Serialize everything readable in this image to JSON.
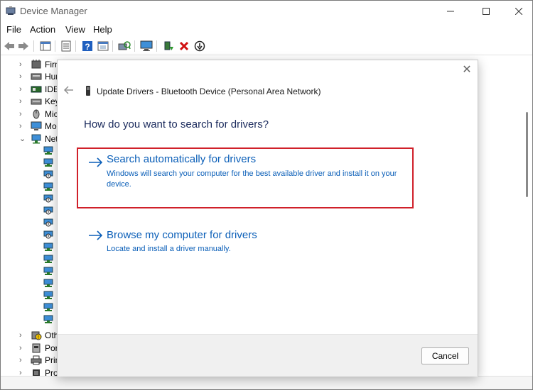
{
  "window": {
    "title": "Device Manager",
    "controls": {
      "minimize": "—",
      "maximize": "☐",
      "close": "✕"
    }
  },
  "menu": [
    "File",
    "Action",
    "View",
    "Help"
  ],
  "toolbar": {
    "icons": [
      "back-arrow-icon",
      "forward-arrow-icon",
      "properties-icon",
      "show-hidden-icon",
      "help-icon",
      "console-tree-icon",
      "scan-hardware-icon",
      "monitor-icon",
      "update-driver-icon",
      "uninstall-device-icon",
      "disable-device-icon"
    ]
  },
  "tree": {
    "items": [
      {
        "label": "Firmware",
        "visible_text": "Firm",
        "expanded": false
      },
      {
        "label": "Human Interface Devices",
        "visible_text": "Hum",
        "expanded": false
      },
      {
        "label": "IDE ATA/ATAPI controllers",
        "visible_text": "IDE",
        "expanded": false
      },
      {
        "label": "Keyboards",
        "visible_text": "Key",
        "expanded": false
      },
      {
        "label": "Mice and other pointing devices",
        "visible_text": "Mic",
        "expanded": false
      },
      {
        "label": "Monitors",
        "visible_text": "Mo",
        "expanded": false
      },
      {
        "label": "Network adapters",
        "visible_text": "Net",
        "expanded": true
      },
      {
        "label": "Other devices",
        "visible_text": "Oth",
        "expanded": false
      },
      {
        "label": "Ports (COM & LPT)",
        "visible_text": "Por",
        "expanded": false
      },
      {
        "label": "Print queues",
        "visible_text": "Prin",
        "expanded": false
      },
      {
        "label": "Processors",
        "visible_text": "Processors",
        "expanded": false
      }
    ],
    "network_child_count": 16
  },
  "dialog": {
    "title": "Update Drivers - Bluetooth Device (Personal Area Network)",
    "question": "How do you want to search for drivers?",
    "options": [
      {
        "title": "Search automatically for drivers",
        "description": "Windows will search your computer for the best available driver and install it on your device.",
        "highlighted": true
      },
      {
        "title": "Browse my computer for drivers",
        "description": "Locate and install a driver manually.",
        "highlighted": false
      }
    ],
    "cancel_label": "Cancel",
    "close_glyph": "✕"
  },
  "colors": {
    "link_blue": "#0b5fb8",
    "highlight_red": "#d0202a",
    "question_text": "#1a2a5c"
  }
}
